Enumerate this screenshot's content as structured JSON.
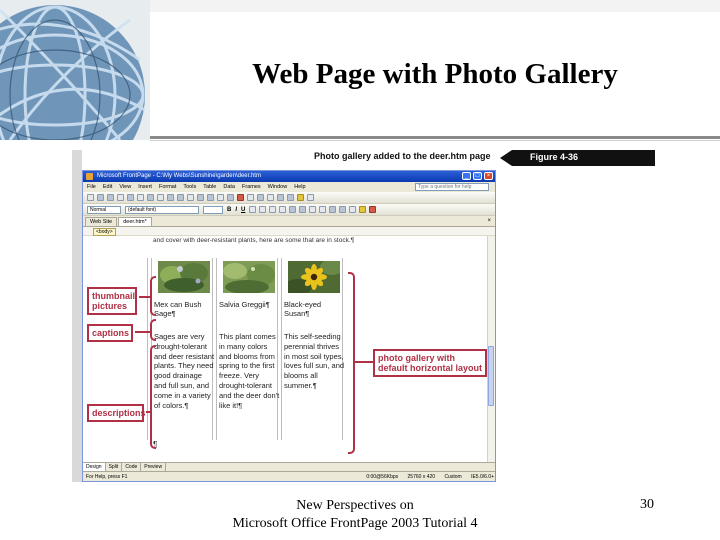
{
  "slide": {
    "title": "Web Page with Photo Gallery",
    "footer_line1": "New Perspectives on",
    "footer_line2": "Microsoft Office FrontPage 2003 Tutorial 4",
    "page_number": "30"
  },
  "figure": {
    "caption": "Photo gallery added to the deer.htm page",
    "label": "Figure 4-36"
  },
  "app": {
    "window_title": "Microsoft FrontPage - C:\\My Webs\\Sunshine\\garden\\deer.htm",
    "menus": [
      "File",
      "Edit",
      "View",
      "Insert",
      "Format",
      "Tools",
      "Table",
      "Data",
      "Frames",
      "Window",
      "Help"
    ],
    "help_placeholder": "Type a question for help",
    "style_value": "Normal",
    "font_value": "(default font)",
    "tabs": [
      "Web Site",
      "deer.htm*"
    ],
    "tab_close": "×",
    "tag_selector": "<body>",
    "view_tabs": [
      "Design",
      "Split",
      "Code",
      "Preview"
    ],
    "status_left": "For Help, press F1",
    "status_right": [
      "0:00@56Kbps",
      "25760 x 420",
      "Custom",
      "IE5.0/6.0+"
    ]
  },
  "page_content": {
    "top_text": "and cover with deer-resistant plants, here are some that are in stock.¶",
    "gallery": [
      {
        "caption": "Mex can Bush Sage¶",
        "description": "Sages are very drought-tolerant and deer resistant plants. They need good drainage and full sun, and come in a variety of colors.¶"
      },
      {
        "caption": "Salvia Greggii¶",
        "description": "This plant comes in many colors and blooms from spring to the first freeze. Very drought-tolerant and the deer don't like it!¶"
      },
      {
        "caption": "Black-eyed Susan¶",
        "description": "This self-seeding perennial thrives in most soil types, loves full sun, and blooms all summer.¶"
      }
    ],
    "end_mark": "¶"
  },
  "callouts": {
    "thumbnails": "thumbnail pictures",
    "captions": "captions",
    "descriptions": "descriptions",
    "gallery_layout": "photo gallery with default horizontal layout"
  },
  "colors": {
    "callout": "#b03045",
    "titlebar": "#0a3ab0"
  }
}
